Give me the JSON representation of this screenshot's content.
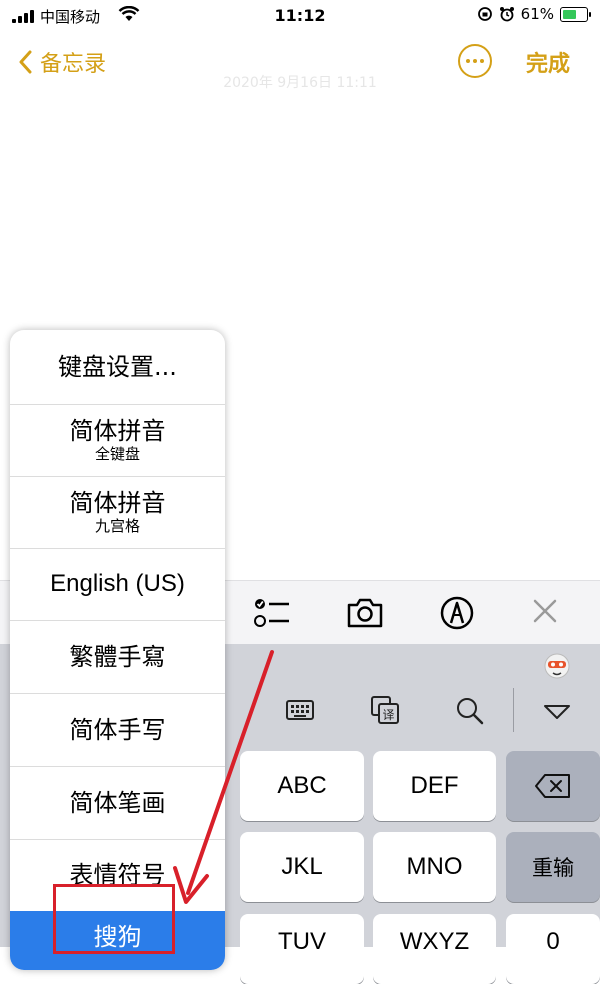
{
  "status_bar": {
    "carrier": "中国移动",
    "time": "11:12",
    "battery": "61%",
    "battery_level": 0.61
  },
  "nav": {
    "back_label": "备忘录",
    "done_label": "完成"
  },
  "note": {
    "faded_date": "2020年 9月16日 11:11"
  },
  "toolbar": {
    "icons": [
      "checklist-icon",
      "camera-icon",
      "markup-pen-icon",
      "close-icon"
    ]
  },
  "keyboard_bar": {
    "icons": [
      "sogou-logo-icon",
      "keyboard-icon",
      "translate-icon",
      "search-icon",
      "hide-keyboard-icon"
    ]
  },
  "keys": {
    "abc": "ABC",
    "def": "DEF",
    "jkl": "JKL",
    "mno": "MNO",
    "reenter": "重输",
    "tuv": "TUV",
    "wxyz": "WXYZ",
    "zero": "0"
  },
  "menu": {
    "items": [
      {
        "label": "键盘设置..."
      },
      {
        "label": "简体拼音",
        "sub": "全键盘"
      },
      {
        "label": "简体拼音",
        "sub": "九宫格"
      },
      {
        "label": "English (US)"
      },
      {
        "label": "繁體手寫"
      },
      {
        "label": "简体手写"
      },
      {
        "label": "简体笔画"
      },
      {
        "label": "表情符号"
      },
      {
        "label": "搜狗"
      }
    ],
    "selected_index": 8
  },
  "colors": {
    "accent": "#d4a017",
    "selected": "#2b7de9",
    "annotation": "#d8202a"
  }
}
